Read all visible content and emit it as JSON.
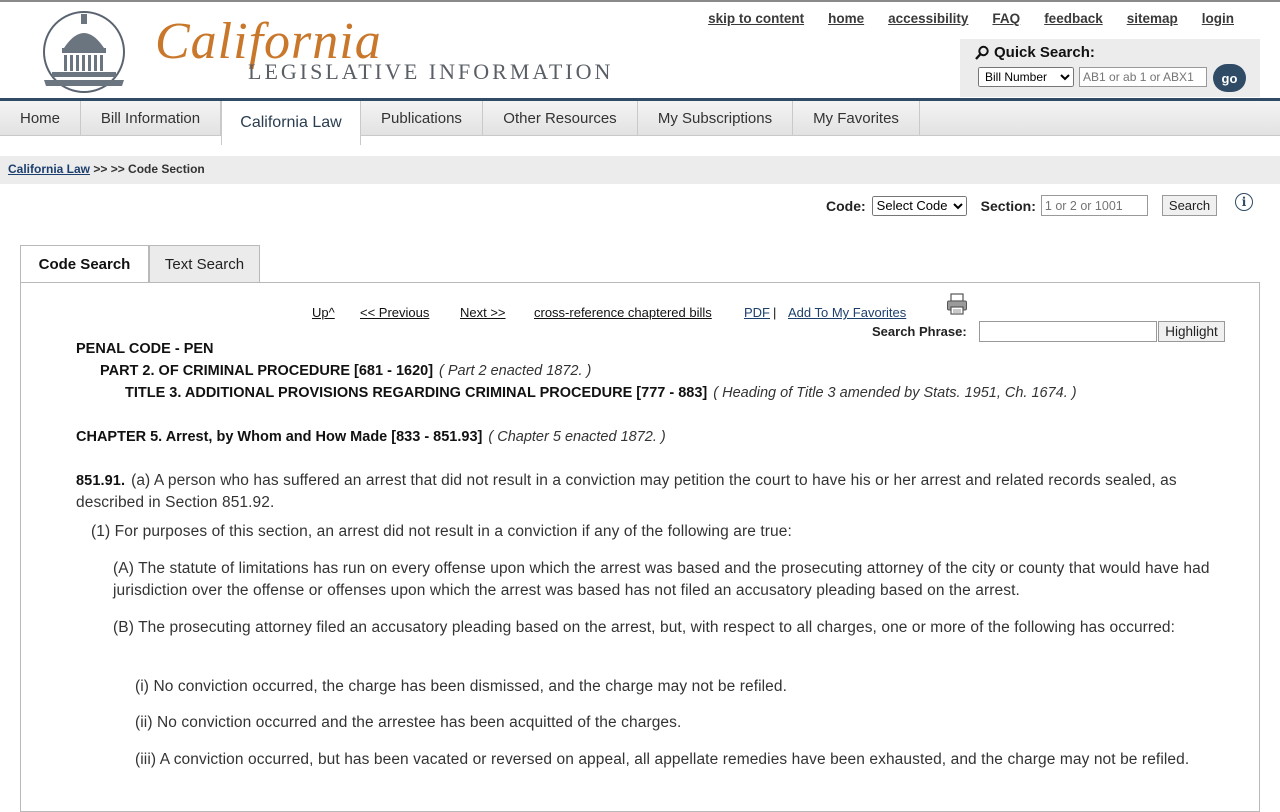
{
  "header": {
    "logo_script": "California",
    "logo_sub": "LEGISLATIVE INFORMATION",
    "top_links": [
      "skip to content",
      "home",
      "accessibility",
      "FAQ",
      "feedback",
      "sitemap",
      "login"
    ],
    "quick_search": {
      "title": "Quick Search:",
      "select_value": "Bill Number",
      "input_placeholder": "AB1 or ab 1 or ABX1",
      "go_label": "go"
    }
  },
  "nav": {
    "items": [
      "Home",
      "Bill Information",
      "California Law",
      "Publications",
      "Other Resources",
      "My Subscriptions",
      "My Favorites"
    ],
    "active": "California Law"
  },
  "breadcrumb": {
    "link": "California Law",
    "rest": " >> >> Code Section"
  },
  "code_search": {
    "code_label": "Code:",
    "code_select": "Select Code",
    "section_label": "Section:",
    "section_placeholder": "1 or 2 or 1001",
    "search_button": "Search"
  },
  "tabs": [
    "Code Search",
    "Text Search"
  ],
  "doc_links": {
    "up": "Up^",
    "previous": "<< Previous",
    "next": "Next >>",
    "cross_ref": "cross-reference chaptered bills",
    "pdf": "PDF",
    "favorites": "Add To My Favorites"
  },
  "search_phrase": {
    "label": "Search Phrase:",
    "button": "Highlight"
  },
  "document": {
    "code": "PENAL CODE - PEN",
    "part": "PART 2. OF CRIMINAL PROCEDURE [681 - 1620]",
    "part_note": "( Part 2 enacted 1872. )",
    "title": "TITLE 3. ADDITIONAL PROVISIONS REGARDING CRIMINAL PROCEDURE [777 - 883]",
    "title_note": "( Heading of Title 3 amended by Stats. 1951, Ch. 1674. )",
    "chapter": "CHAPTER 5. Arrest, by Whom and How Made [833 - 851.93]",
    "chapter_note": "( Chapter 5 enacted 1872. )",
    "section_number": "851.91.",
    "para_a": "(a) A person who has suffered an arrest that did not result in a conviction may petition the court to have his or her arrest and related records sealed, as described in Section 851.92.",
    "para_1": "(1) For purposes of this section, an arrest did not result in a conviction if any of the following are true:",
    "para_A": "(A) The statute of limitations has run on every offense upon which the arrest was based and the prosecuting attorney of the city or county that would have had jurisdiction over the offense or offenses upon which the arrest was based has not filed an accusatory pleading based on the arrest.",
    "para_B": "(B) The prosecuting attorney filed an accusatory pleading based on the arrest, but, with respect to all charges, one or more of the following has occurred:",
    "para_i": "(i) No conviction occurred, the charge has been dismissed, and the charge may not be refiled.",
    "para_ii": "(ii) No conviction occurred and the arrestee has been acquitted of the charges.",
    "para_iii": "(iii) A conviction occurred, but has been vacated or reversed on appeal, all appellate remedies have been exhausted, and the charge may not be refiled."
  },
  "colors": {
    "accent_navy": "#2f4b66",
    "logo_orange": "#c8772b",
    "link_blue": "#1d3f6e"
  }
}
